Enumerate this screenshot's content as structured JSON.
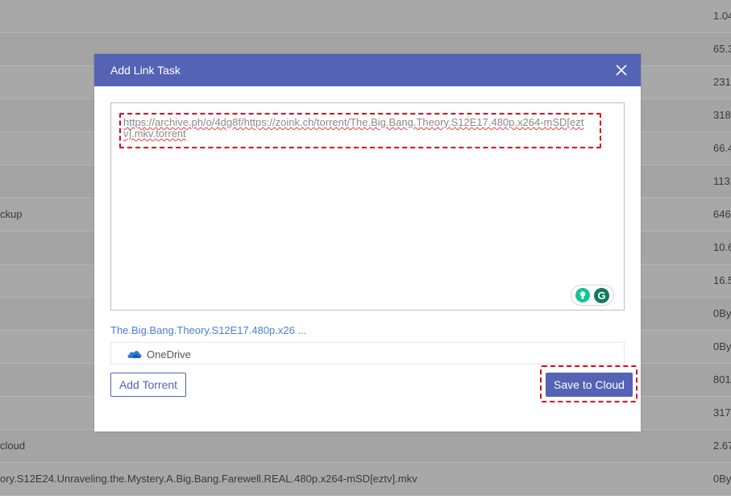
{
  "background": {
    "rows": [
      {
        "name": "",
        "size": "1.04"
      },
      {
        "name": "",
        "size": "65.3"
      },
      {
        "name": "",
        "size": "231"
      },
      {
        "name": "",
        "size": "318"
      },
      {
        "name": "",
        "size": "66.4"
      },
      {
        "name": "",
        "size": "113"
      },
      {
        "name": "ckup",
        "size": "646"
      },
      {
        "name": "",
        "size": "10.6"
      },
      {
        "name": "",
        "size": "16.5"
      },
      {
        "name": "",
        "size": "0By"
      },
      {
        "name": "",
        "size": "0By"
      },
      {
        "name": "",
        "size": "801"
      },
      {
        "name": "",
        "size": "317"
      },
      {
        "name": "cloud",
        "size": "2.67"
      },
      {
        "name": "ory.S12E24.Unraveling.the.Mystery.A.Big.Bang.Farewell.REAL.480p.x264-mSD[eztv].mkv",
        "size": "0By"
      }
    ]
  },
  "dialog": {
    "title": "Add Link Task",
    "url_value": "https://archive.ph/o/4dg8f/https://zoink.ch/torrent/The.Big.Bang.Theory.S12E17.480p.x264-mSD[eztv].mkv.torrent",
    "grammarly_letter": "G",
    "file_name": "The.Big.Bang.Theory.S12E17.480p.x26 ...",
    "destination": {
      "icon": "onedrive-cloud-icon",
      "label": "OneDrive"
    },
    "add_torrent_label": "Add Torrent",
    "save_label": "Save to Cloud"
  },
  "colors": {
    "accent": "#5463b4",
    "highlight": "#e0001a",
    "overlay": "#a8a8a8",
    "link": "#4a7fd6"
  }
}
